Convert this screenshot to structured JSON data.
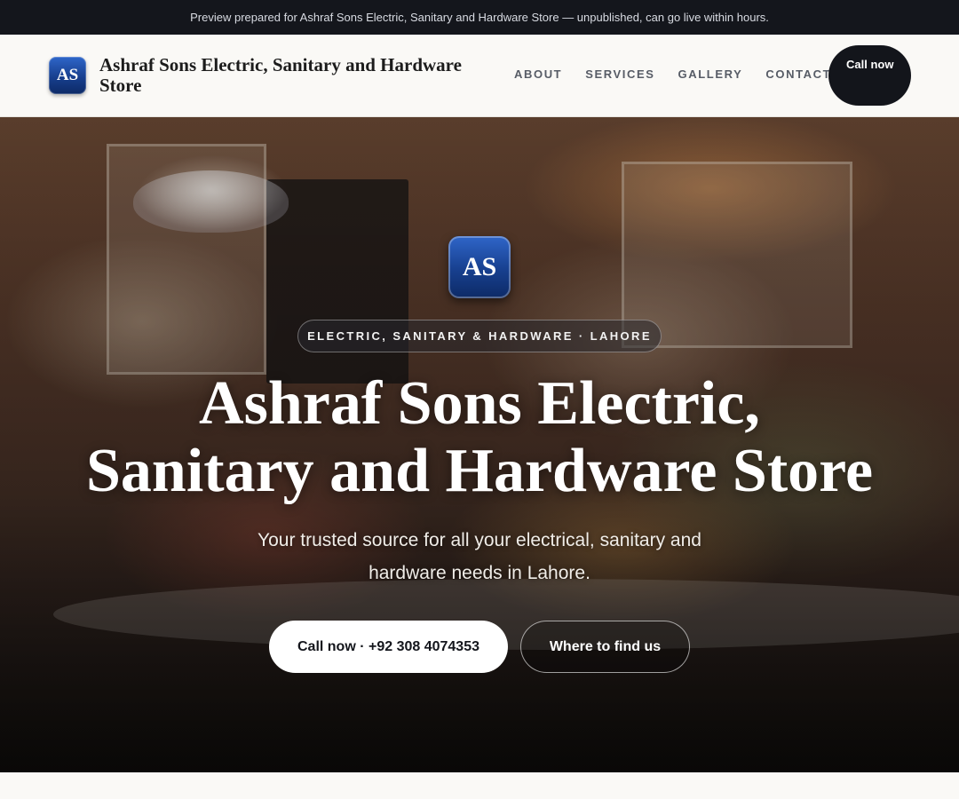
{
  "preview_banner": {
    "text": "Preview prepared for Ashraf Sons Electric, Sanitary and Hardware Store — unpublished, can go live within hours."
  },
  "header": {
    "logo_initials": "AS",
    "brand_name": "Ashraf Sons Electric, Sanitary and Hardware Store",
    "nav": [
      {
        "label": "ABOUT"
      },
      {
        "label": "SERVICES"
      },
      {
        "label": "GALLERY"
      },
      {
        "label": "CONTACT"
      }
    ],
    "call_button": "Call now"
  },
  "hero": {
    "logo_initials": "AS",
    "tagline": "ELECTRIC, SANITARY & HARDWARE · LAHORE",
    "title": "Ashraf Sons Electric, Sanitary and Hardware Store",
    "subtitle": "Your trusted source for all your electrical, sanitary and hardware needs in Lahore.",
    "primary_button": "Call now · +92 308 4074353",
    "secondary_button": "Where to find us"
  },
  "colors": {
    "topbar_bg": "#14161c",
    "accent_dark": "#13151b",
    "logo_blue": "#173f8e",
    "page_bg": "#faf9f6"
  }
}
